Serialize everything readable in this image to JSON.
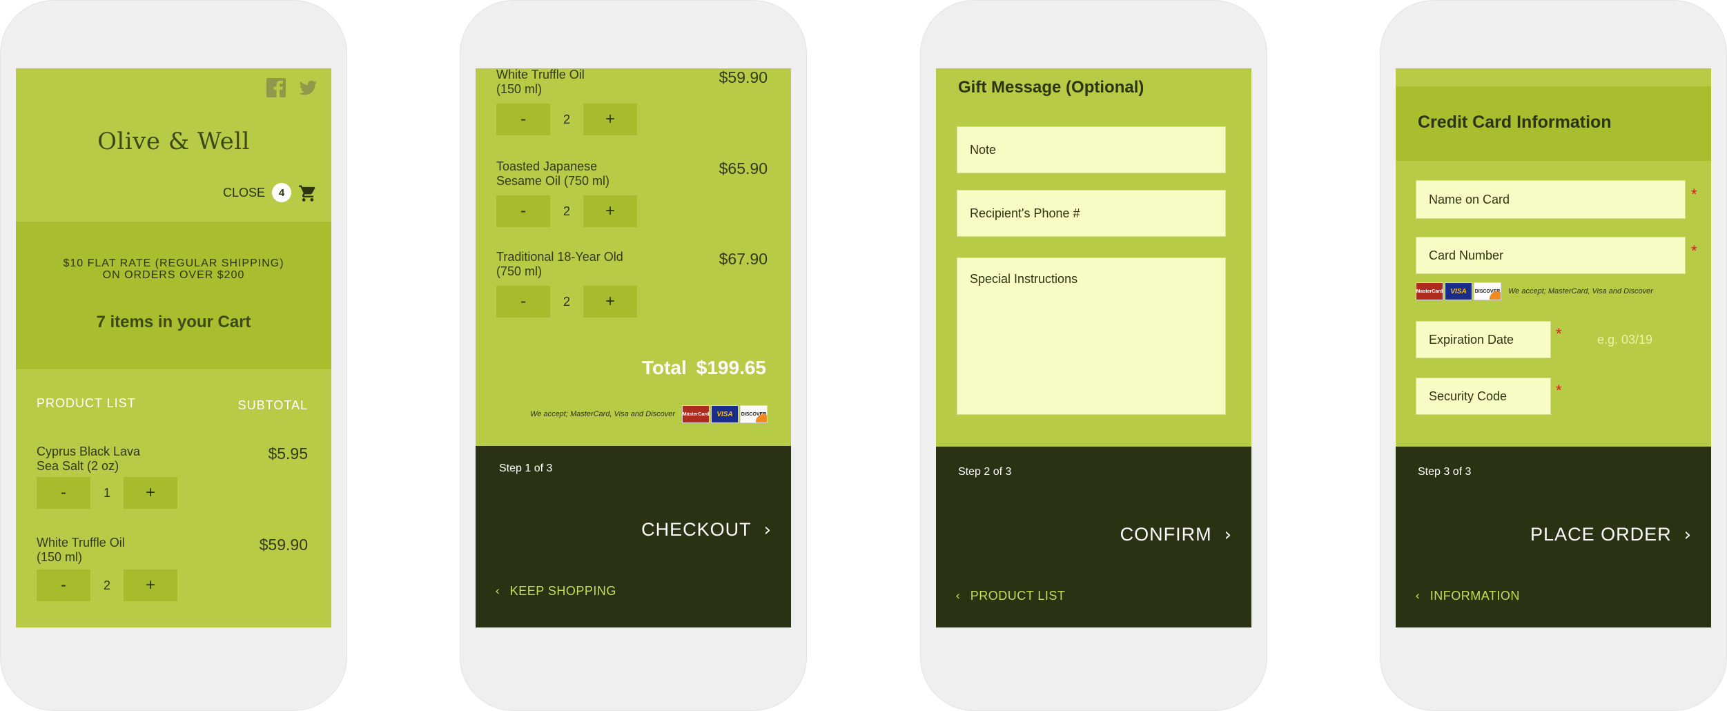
{
  "phone1": {
    "brand": "Olive & Well",
    "close_label": "CLOSE",
    "cart_count": "4",
    "shipping_line1": "$10 FLAT RATE (REGULAR SHIPPING)",
    "shipping_line2": "ON ORDERS OVER $200",
    "items_summary": "7 items in your Cart",
    "col_product": "PRODUCT LIST",
    "col_subtotal": "SUBTOTAL",
    "items": [
      {
        "name_line1": "Cyprus Black Lava",
        "name_line2": "Sea Salt (2 oz)",
        "price": "$5.95",
        "qty": "1"
      },
      {
        "name_line1": "White Truffle Oil",
        "name_line2": "(150 ml)",
        "price": "$59.90",
        "qty": "2"
      }
    ]
  },
  "stepper": {
    "minus": "-",
    "plus": "+"
  },
  "phone2": {
    "items": [
      {
        "name_line1": "White Truffle Oil",
        "name_line2": "(150 ml)",
        "price": "$59.90",
        "qty": "2"
      },
      {
        "name_line1": "Toasted Japanese",
        "name_line2": "Sesame Oil (750 ml)",
        "price": "$65.90",
        "qty": "2"
      },
      {
        "name_line1": "Traditional 18-Year Old",
        "name_line2": "(750 ml)",
        "price": "$67.90",
        "qty": "2"
      }
    ],
    "total_label": "Total",
    "total_value": "$199.65",
    "accept_text": "We accept; MasterCard, Visa and Discover",
    "step": "Step 1 of 3",
    "primary": "CHECKOUT",
    "back": "KEEP SHOPPING"
  },
  "cards": {
    "mastercard": "MasterCard",
    "visa": "VISA",
    "discover": "DISCOVER"
  },
  "phone3": {
    "title": "Gift Message (Optional)",
    "note_placeholder": "Note",
    "phone_placeholder": "Recipient's Phone #",
    "instructions_placeholder": "Special Instructions",
    "step": "Step 2 of 3",
    "primary": "CONFIRM",
    "back": "PRODUCT LIST"
  },
  "phone4": {
    "title": "Credit Card Information",
    "name_placeholder": "Name on Card",
    "number_placeholder": "Card Number",
    "accept_text": "We accept; MasterCard, Visa and Discover",
    "expiry_placeholder": "Expiration Date",
    "expiry_hint": "e.g. 03/19",
    "cvc_placeholder": "Security Code",
    "required_mark": "*",
    "step": "Step 3 of 3",
    "primary": "PLACE ORDER",
    "back": "INFORMATION"
  },
  "colors": {
    "screen_bg": "#b7cb47",
    "band_bg": "#a8be2e",
    "footer_bg": "#2a3213",
    "field_bg": "#f7fcc4",
    "required": "#d42020"
  },
  "icons": {
    "facebook": "facebook-icon",
    "twitter": "twitter-icon",
    "cart": "cart-icon",
    "chevron_right": "chevron-right-icon",
    "chevron_left": "chevron-left-icon"
  }
}
